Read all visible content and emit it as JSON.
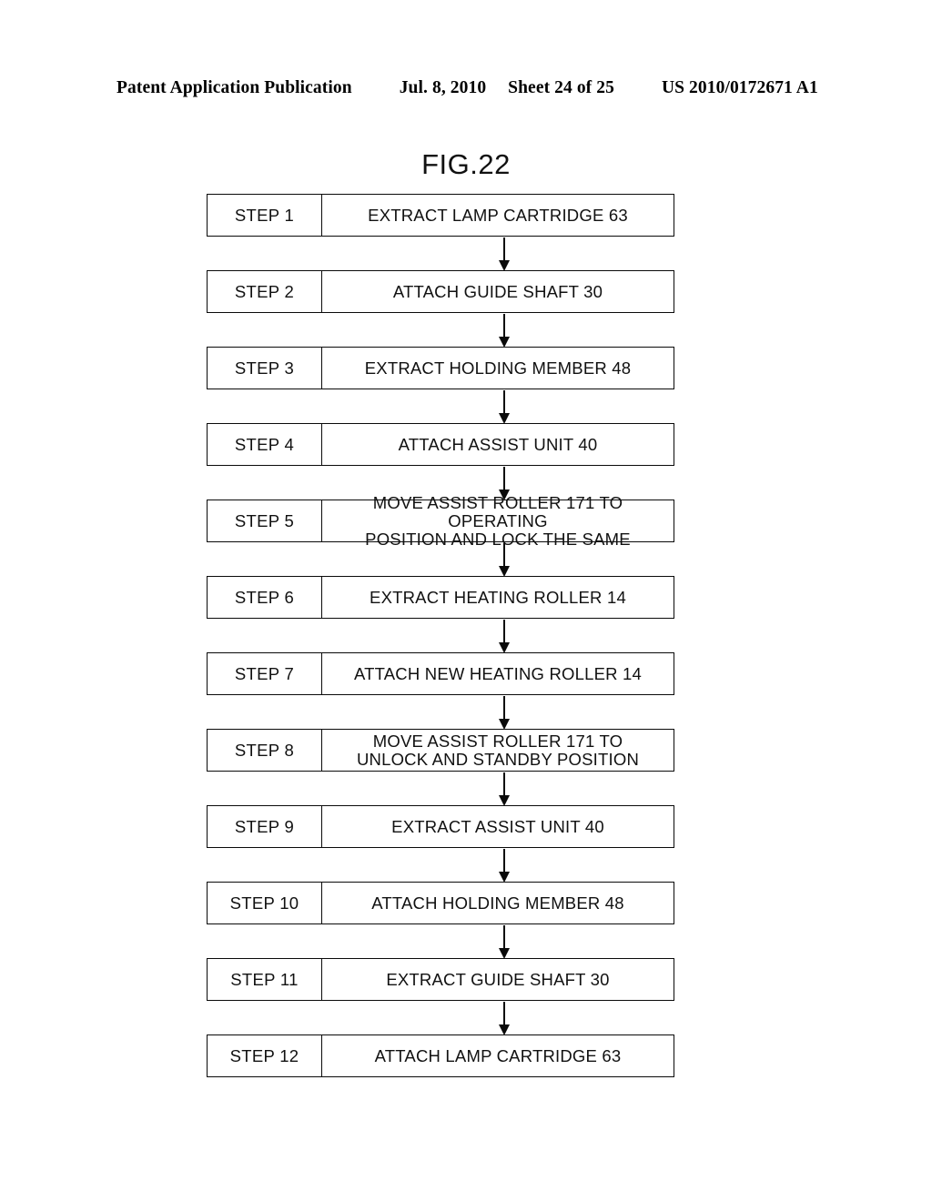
{
  "header": {
    "publication": "Patent Application Publication",
    "date": "Jul. 8, 2010",
    "sheet": "Sheet 24 of 25",
    "document_number": "US 2010/0172671 A1"
  },
  "figure": {
    "title": "FIG.22"
  },
  "flowchart": {
    "type": "flowchart",
    "orientation": "vertical",
    "connector": "down-arrow",
    "steps": [
      {
        "label": "STEP 1",
        "text": "EXTRACT LAMP CARTRIDGE 63"
      },
      {
        "label": "STEP 2",
        "text": "ATTACH GUIDE SHAFT 30"
      },
      {
        "label": "STEP 3",
        "text": "EXTRACT HOLDING MEMBER 48"
      },
      {
        "label": "STEP 4",
        "text": "ATTACH ASSIST UNIT 40"
      },
      {
        "label": "STEP 5",
        "text": "MOVE ASSIST ROLLER 171 TO OPERATING\nPOSITION AND LOCK THE SAME"
      },
      {
        "label": "STEP 6",
        "text": "EXTRACT HEATING ROLLER 14"
      },
      {
        "label": "STEP 7",
        "text": "ATTACH NEW HEATING ROLLER 14"
      },
      {
        "label": "STEP 8",
        "text": "MOVE ASSIST ROLLER 171 TO\nUNLOCK AND STANDBY POSITION"
      },
      {
        "label": "STEP 9",
        "text": "EXTRACT ASSIST UNIT 40"
      },
      {
        "label": "STEP 10",
        "text": "ATTACH HOLDING MEMBER 48"
      },
      {
        "label": "STEP 11",
        "text": "EXTRACT GUIDE SHAFT 30"
      },
      {
        "label": "STEP 12",
        "text": "ATTACH LAMP CARTRIDGE 63"
      }
    ]
  },
  "colors": {
    "page_background": "#ffffff",
    "ink": "#0a0a0a",
    "text": "#111111"
  }
}
